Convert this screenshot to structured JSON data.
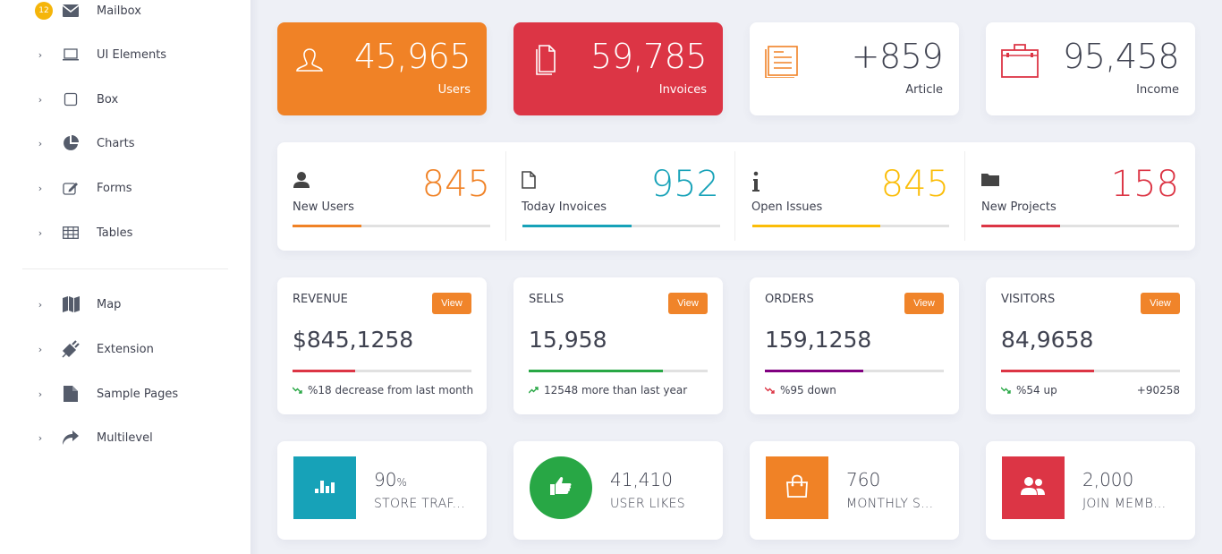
{
  "sidebar": {
    "mailbox_badge": "12",
    "items": [
      {
        "label": "Mailbox",
        "icon": "envelope-icon"
      },
      {
        "label": "UI Elements",
        "icon": "laptop-icon"
      },
      {
        "label": "Box",
        "icon": "square-icon"
      },
      {
        "label": "Charts",
        "icon": "pie-chart-icon"
      },
      {
        "label": "Forms",
        "icon": "edit-icon"
      },
      {
        "label": "Tables",
        "icon": "table-icon"
      },
      {
        "label": "Map",
        "icon": "map-icon"
      },
      {
        "label": "Extension",
        "icon": "plug-icon"
      },
      {
        "label": "Sample Pages",
        "icon": "file-icon"
      },
      {
        "label": "Multilevel",
        "icon": "share-icon"
      }
    ],
    "chevron": "›"
  },
  "top_cards": [
    {
      "value": "45,965",
      "label": "Users",
      "icon": "user-outline-icon",
      "bg": "#f08226",
      "fg": "#ffffff"
    },
    {
      "value": "59,785",
      "label": "Invoices",
      "icon": "documents-icon",
      "bg": "#dc3545",
      "fg": "#ffffff"
    },
    {
      "value": "+859",
      "label": "Article",
      "icon": "article-icon",
      "bg": "#ffffff",
      "fg": "#3f4250",
      "icon_color": "#f08226"
    },
    {
      "value": "95,458",
      "label": "Income",
      "icon": "briefcase-icon",
      "bg": "#ffffff",
      "fg": "#3f4250",
      "icon_color": "#dc3545"
    }
  ],
  "stats": [
    {
      "value": "845",
      "label": "New Users",
      "icon": "user-icon",
      "color": "#f08226",
      "progress_percent": 35
    },
    {
      "value": "952",
      "label": "Today Invoices",
      "icon": "file-outline-icon",
      "color": "#17a2b8",
      "progress_percent": 55
    },
    {
      "value": "845",
      "label": "Open Issues",
      "icon": "info-icon",
      "color": "#fbbd08",
      "progress_percent": 65
    },
    {
      "value": "158",
      "label": "New Projects",
      "icon": "folder-icon",
      "color": "#dc3545",
      "progress_percent": 40
    }
  ],
  "metrics": [
    {
      "title": "REVENUE",
      "button": "View",
      "amount": "$845,1258",
      "color": "#dc3545",
      "progress_percent": 35,
      "trend_icon": "trend-down-icon",
      "trend_color": "#28a745",
      "note": "%18 decrease from last month",
      "extra": ""
    },
    {
      "title": "SELLS",
      "button": "View",
      "amount": "15,958",
      "color": "#28a745",
      "progress_percent": 75,
      "trend_icon": "trend-up-icon",
      "trend_color": "#28a745",
      "note": "12548 more than last year",
      "extra": ""
    },
    {
      "title": "ORDERS",
      "button": "View",
      "amount": "159,1258",
      "color": "#800080",
      "progress_percent": 55,
      "trend_icon": "trend-down-icon",
      "trend_color": "#dc3545",
      "note": "%95 down",
      "extra": ""
    },
    {
      "title": "VISITORS",
      "button": "View",
      "amount": "84,9658",
      "color": "#dc3545",
      "progress_percent": 52,
      "trend_icon": "trend-down-icon",
      "trend_color": "#28a745",
      "note": "%54 up",
      "extra": "+90258"
    }
  ],
  "info_boxes": [
    {
      "value": "90",
      "suffix": "%",
      "label": "STORE TRAF...",
      "icon": "bar-chart-icon",
      "bg": "#17a2b8",
      "shape": "square"
    },
    {
      "value": "41,410",
      "suffix": "",
      "label": "USER LIKES",
      "icon": "thumbs-up-icon",
      "bg": "#28a745",
      "shape": "circle"
    },
    {
      "value": "760",
      "suffix": "",
      "label": "MONTHLY S...",
      "icon": "shopping-bag-icon",
      "bg": "#f08226",
      "shape": "square"
    },
    {
      "value": "2,000",
      "suffix": "",
      "label": "JOIN MEMB...",
      "icon": "users-icon",
      "bg": "#dc3545",
      "shape": "square"
    }
  ]
}
